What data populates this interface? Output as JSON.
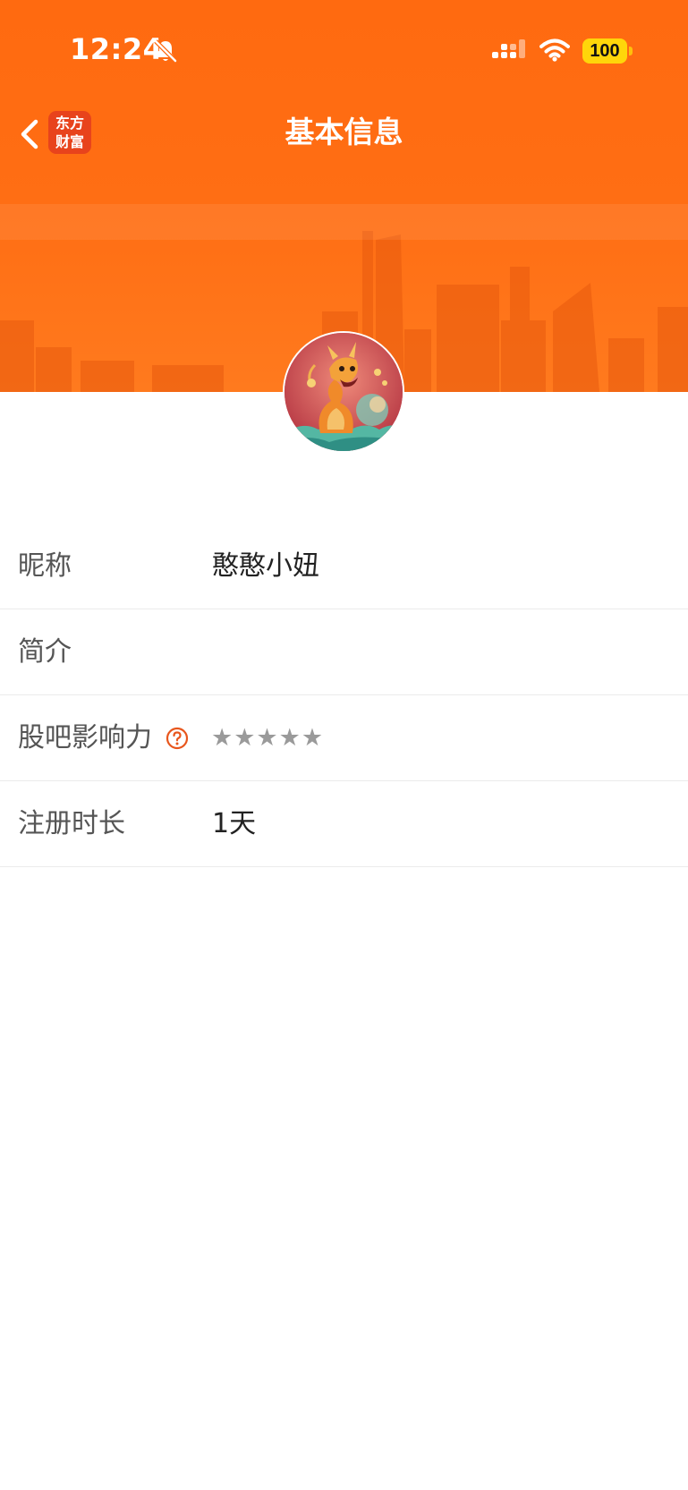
{
  "status_bar": {
    "time": "12:24",
    "battery_level": "100",
    "icons": [
      "bell-muted-icon",
      "cellular-signal-icon",
      "wifi-icon",
      "battery-icon"
    ]
  },
  "nav": {
    "back_icon": "chevron-left-icon",
    "logo_line1": "东方",
    "logo_line2": "财富",
    "title": "基本信息"
  },
  "profile": {
    "avatar_icon": "dragon-avatar"
  },
  "info": {
    "nickname_label": "昵称",
    "nickname_value": "憨憨小妞",
    "bio_label": "简介",
    "bio_value": "",
    "influence_label": "股吧影响力",
    "influence_help_icon": "question-circle-icon",
    "influence_stars": "★★★★★",
    "influence_rating": 0,
    "influence_max": 5,
    "registration_label": "注册时长",
    "registration_value": "1天"
  },
  "colors": {
    "header_orange": "#ff6a10",
    "logo_red": "#e8431c",
    "battery_yellow": "#ffd60a",
    "help_icon": "#e8561c",
    "star_gray": "#9a9a9a"
  }
}
